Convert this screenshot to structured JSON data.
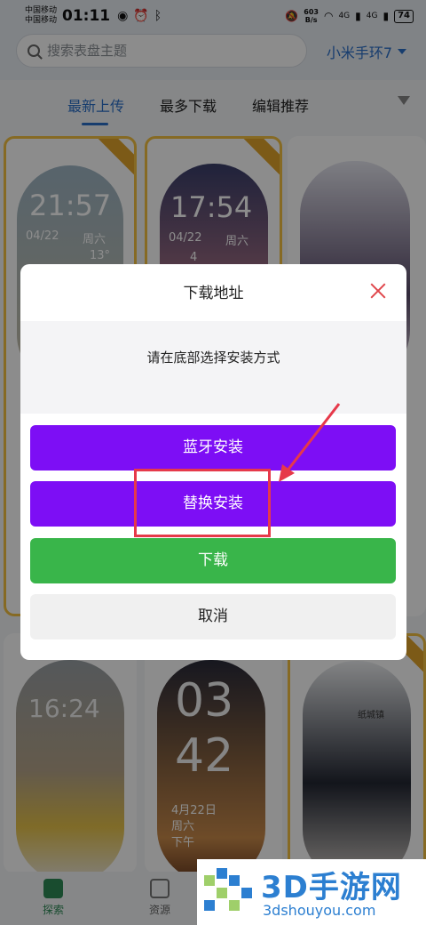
{
  "status_bar": {
    "carrier_1": "中国移动",
    "carrier_2": "中国移动",
    "time": "01:11",
    "net_speed": "603",
    "net_unit": "B/s",
    "signal_1": "4G",
    "signal_2": "4G",
    "battery": "74"
  },
  "header": {
    "search_placeholder": "搜索表盘主题",
    "device": "小米手环7"
  },
  "tabs": [
    {
      "label": "最新上传",
      "active": true
    },
    {
      "label": "最多下载",
      "active": false
    },
    {
      "label": "编辑推荐",
      "active": false
    }
  ],
  "cards": [
    {
      "time": "21:57",
      "date": "04/22",
      "weekday": "周六",
      "temp": "13°"
    },
    {
      "time": "17:54",
      "date": "04/22",
      "weekday": "周六",
      "temp": "4"
    },
    {
      "time": "",
      "date": "",
      "weekday": "",
      "temp": ""
    },
    {
      "time": "16:24"
    },
    {
      "hour": "03",
      "minute": "42",
      "date": "4月22日",
      "weekday": "周六",
      "period": "下午"
    },
    {
      "label": "纸城镇"
    }
  ],
  "dialog": {
    "title": "下载地址",
    "message": "请在底部选择安装方式",
    "buttons": {
      "bluetooth": "蓝牙安装",
      "replace": "替换安装",
      "download": "下载",
      "cancel": "取消"
    }
  },
  "bottom_nav": [
    {
      "label": "探索",
      "active": true
    },
    {
      "label": "资源",
      "active": false
    }
  ],
  "watermark": {
    "brand": "3D手游网",
    "url": "3dshouyou.com"
  },
  "colors": {
    "accent": "#2b6fc9",
    "purple_button": "#7d0ef5",
    "green_button": "#39b54a",
    "highlight": "#e6394a"
  }
}
